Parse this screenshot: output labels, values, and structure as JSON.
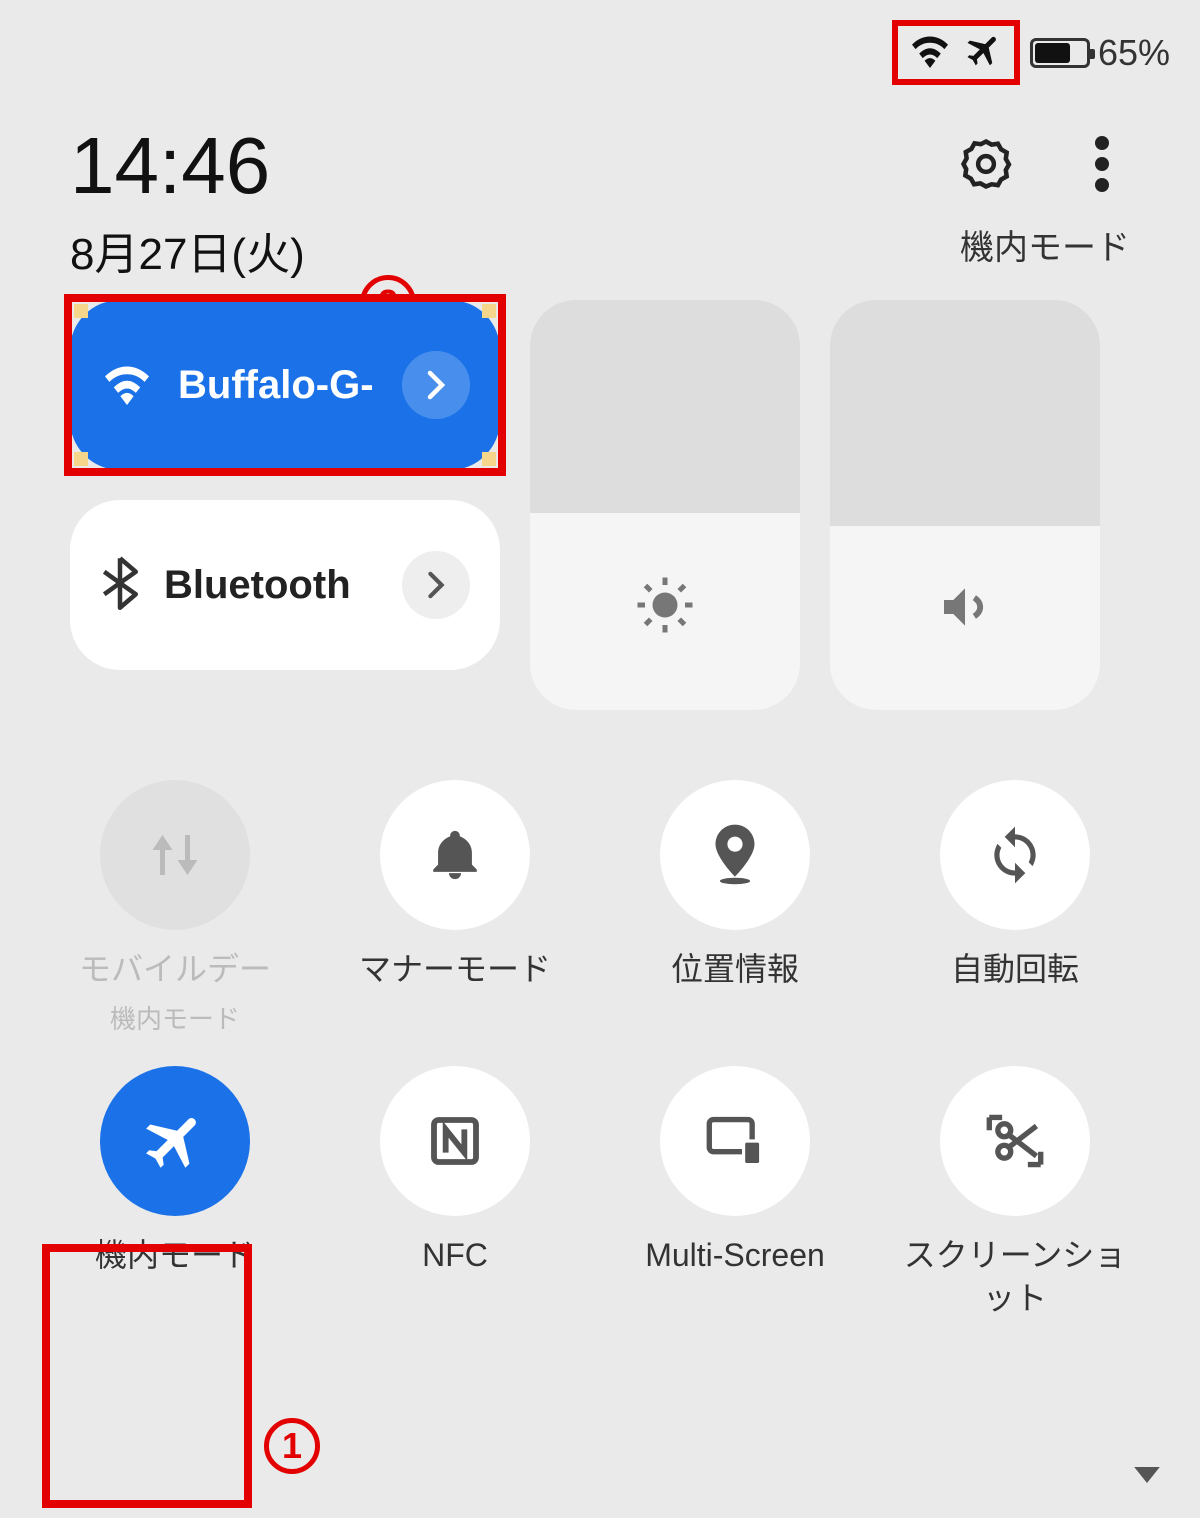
{
  "status": {
    "battery_pct": "65%"
  },
  "header": {
    "time": "14:46",
    "date": "8月27日(火)",
    "mode_text": "機内モード"
  },
  "pills": {
    "wifi_label": "Buffalo-G-",
    "bluetooth_label": "Bluetooth"
  },
  "toggles": {
    "mobile_data": "モバイルデー",
    "mobile_data_sub": "機内モード",
    "silent": "マナーモード",
    "location": "位置情報",
    "rotate": "自動回転",
    "airplane": "機内モード",
    "nfc": "NFC",
    "multiscreen": "Multi-Screen",
    "screenshot": "スクリーンショット"
  },
  "annotations": {
    "one": "1",
    "two": "2"
  }
}
